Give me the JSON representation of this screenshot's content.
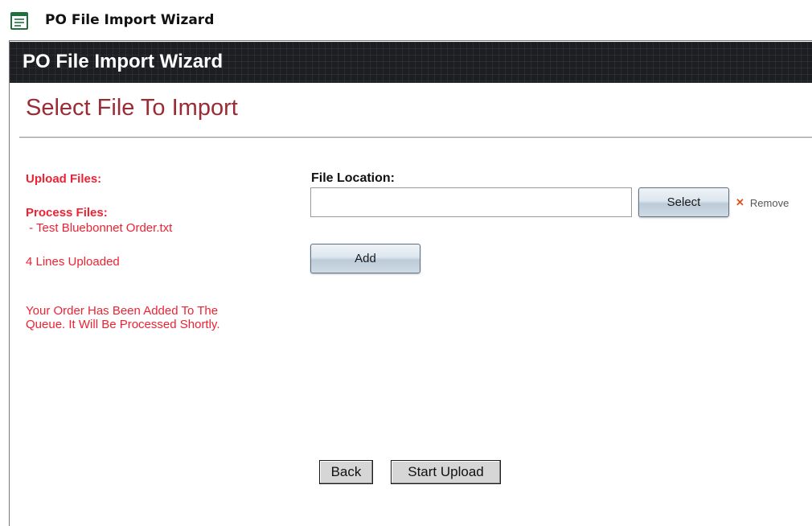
{
  "window": {
    "title": "PO File Import Wizard",
    "icon": "form-window-icon"
  },
  "header": {
    "title": "PO File Import Wizard"
  },
  "section": {
    "title": "Select File To Import"
  },
  "status": {
    "upload_files_label": "Upload Files:",
    "process_files_label": "Process Files:",
    "processed_file": " - Test Bluebonnet Order.txt",
    "lines_uploaded": "4 Lines Uploaded",
    "queue_message_line1": "Your Order Has Been Added To The",
    "queue_message_line2": "Queue. It Will Be Processed Shortly."
  },
  "file_picker": {
    "label": "File Location:",
    "value": "",
    "placeholder": "",
    "select_label": "Select",
    "remove_label": "Remove",
    "add_label": "Add"
  },
  "footer": {
    "back_label": "Back",
    "start_upload_label": "Start Upload"
  },
  "colors": {
    "status_red": "#ee2233",
    "section_title": "#9b2c35",
    "header_bg": "#1c1e22",
    "remove_x": "#e0501e"
  }
}
